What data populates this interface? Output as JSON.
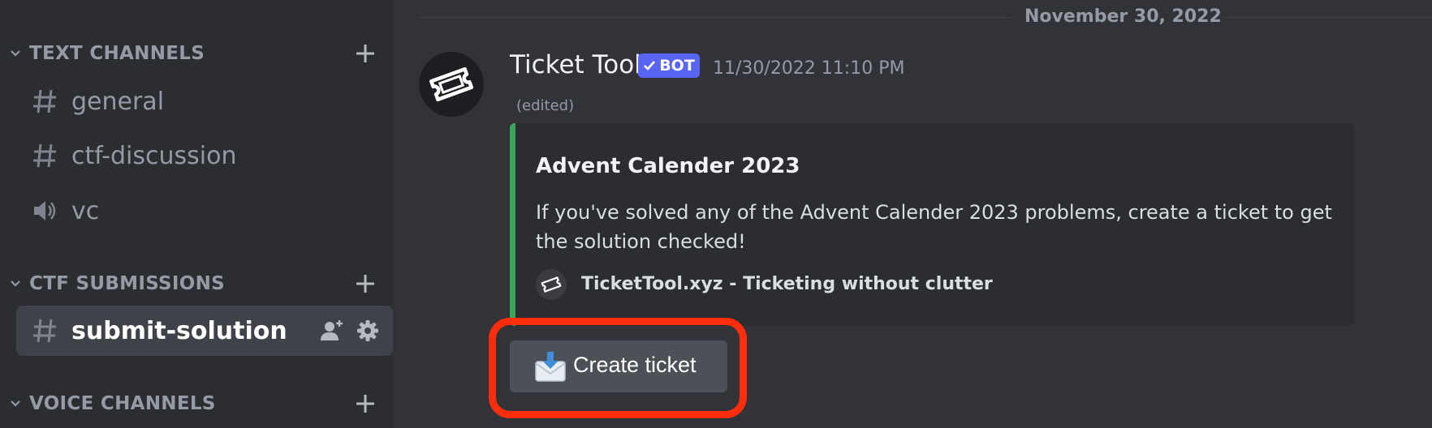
{
  "sidebar": {
    "categories": {
      "text": {
        "label": "TEXT CHANNELS"
      },
      "ctf": {
        "label": "CTF SUBMISSIONS"
      },
      "voice": {
        "label": "VOICE CHANNELS"
      }
    },
    "channels": [
      {
        "name": "general",
        "icon": "hash-icon"
      },
      {
        "name": "ctf-discussion",
        "icon": "hash-icon"
      },
      {
        "name": "vc",
        "icon": "speaker-icon"
      },
      {
        "name": "submit-solution",
        "icon": "hash-icon",
        "active": true
      }
    ]
  },
  "chat": {
    "date_divider": "November 30, 2022",
    "message": {
      "author": "Ticket Tool",
      "bot_tag": "BOT",
      "timestamp": "11/30/2022 11:10 PM",
      "edited": "(edited)",
      "embed": {
        "accent_color": "#3ba55c",
        "title": "Advent Calender 2023",
        "description": "If you've solved any of the Advent Calender 2023 problems, create a ticket to get the solution checked!",
        "footer": "TicketTool.xyz - Ticketing without clutter"
      },
      "button": {
        "label": "Create ticket",
        "icon": "envelope-download-icon"
      }
    }
  },
  "colors": {
    "highlight": "#fe2d0c",
    "bot_tag": "#5865f2",
    "background": "#313338",
    "sidebar": "#2b2d31"
  }
}
